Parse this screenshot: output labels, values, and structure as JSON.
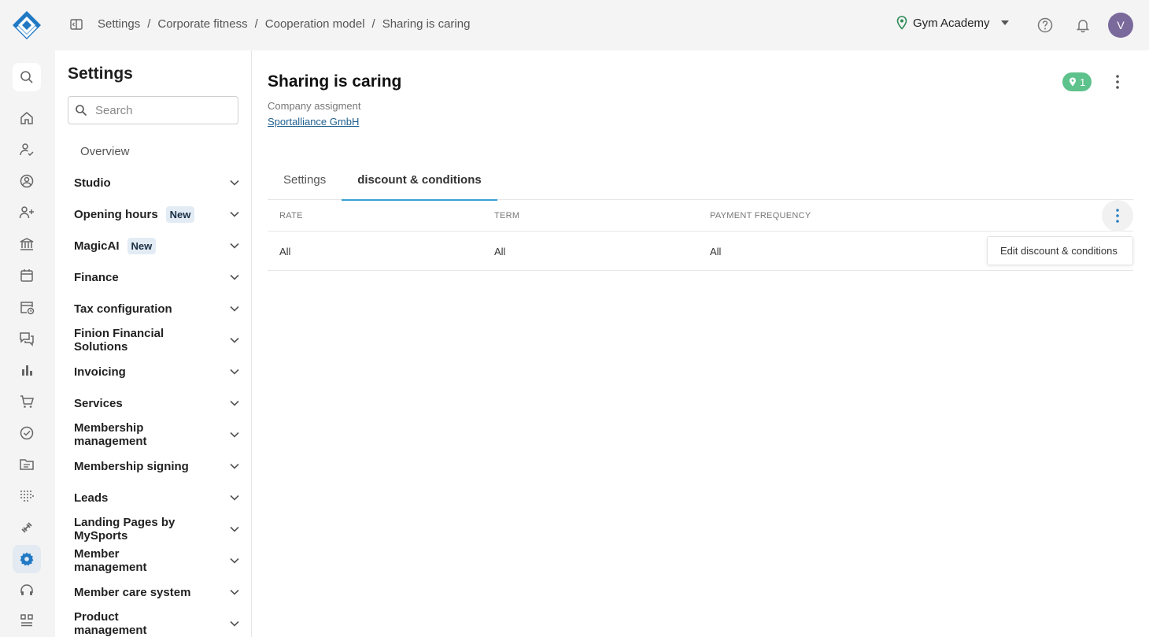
{
  "breadcrumb": [
    "Settings",
    "Corporate fitness",
    "Cooperation model",
    "Sharing is caring"
  ],
  "studio": {
    "name": "Gym Academy"
  },
  "user": {
    "initial": "V"
  },
  "settings": {
    "title": "Settings",
    "search_placeholder": "Search",
    "overview": "Overview",
    "items": [
      {
        "label": "Studio"
      },
      {
        "label": "Opening hours",
        "badge": "New"
      },
      {
        "label": "MagicAI",
        "badge": "New"
      },
      {
        "label": "Finance"
      },
      {
        "label": "Tax configuration"
      },
      {
        "label": "Finion Financial Solutions"
      },
      {
        "label": "Invoicing"
      },
      {
        "label": "Services"
      },
      {
        "label": "Membership management"
      },
      {
        "label": "Membership signing"
      },
      {
        "label": "Leads"
      },
      {
        "label": "Landing Pages by MySports"
      },
      {
        "label": "Member management"
      },
      {
        "label": "Member care system"
      },
      {
        "label": "Product management"
      }
    ]
  },
  "page": {
    "title": "Sharing is caring",
    "subtitle": "Company assigment",
    "company_link": "Sportalliance GmbH",
    "location_count": "1",
    "tabs": [
      "Settings",
      "discount & conditions"
    ],
    "active_tab": 1
  },
  "table": {
    "headers": [
      "RATE",
      "TERM",
      "PAYMENT FREQUENCY"
    ],
    "rows": [
      [
        "All",
        "All",
        "All"
      ]
    ]
  },
  "dropdown": {
    "item": "Edit discount & conditions"
  },
  "colors": {
    "accent": "#2179c4",
    "tab_underline": "#3aa0d8",
    "location_badge": "#5ec28c",
    "avatar": "#7a6a9c"
  }
}
